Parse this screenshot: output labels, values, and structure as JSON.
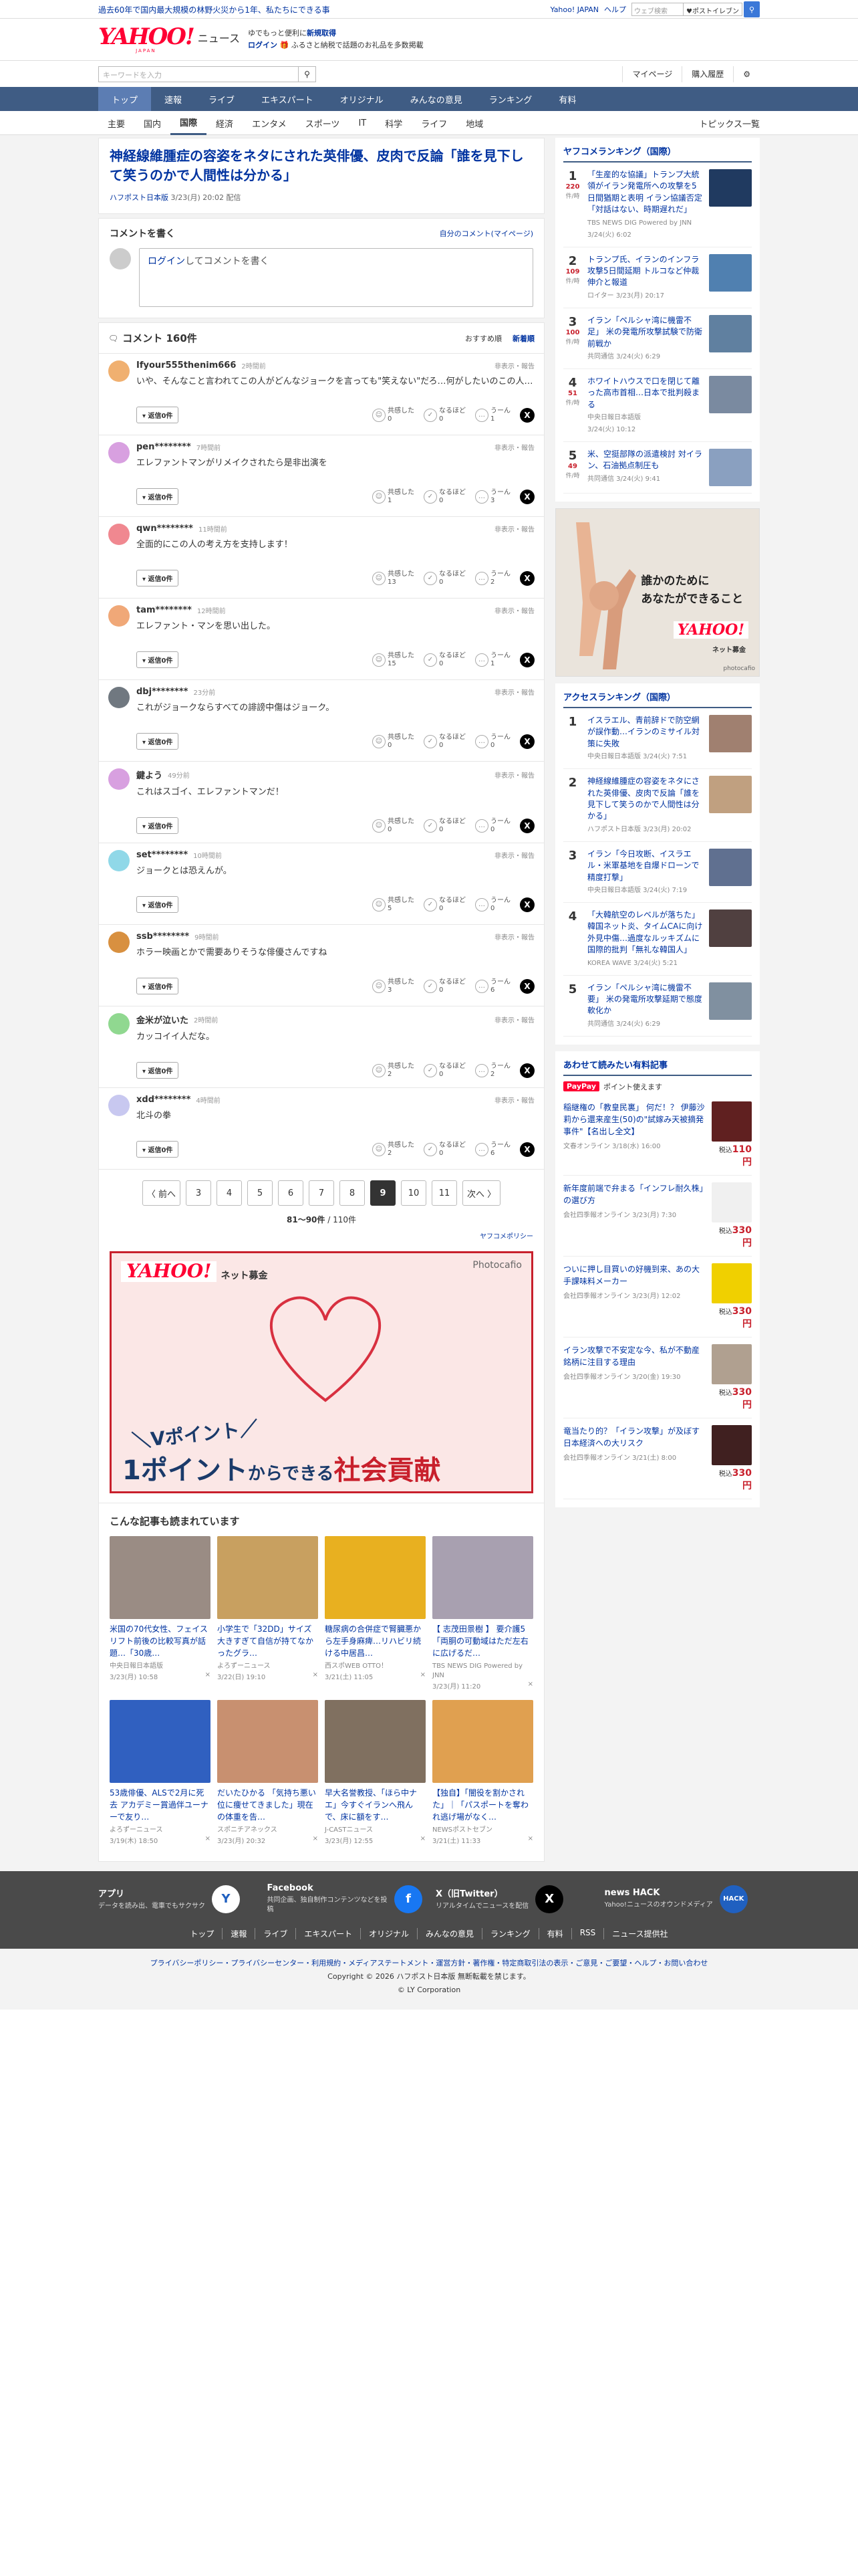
{
  "topbar": {
    "news": "過去60年で国内最大規模の林野火災から1年、私たちにできる事",
    "links": [
      "Yahoo! JAPAN",
      "ヘルプ"
    ],
    "search_placeholder": "ウェブ検索",
    "yell_label": "♥ポストイレブン"
  },
  "header": {
    "logo": "YAHOO!",
    "logo_sub": "JAPAN",
    "service": "ニュース",
    "promo_line1_pre": "ゆでもっと便利に",
    "promo_line1_link": "新規取得",
    "promo_line2_link": "ログイン",
    "promo_line2_text": "🎁 ふるさと納税で話題のお礼品を多数掲載"
  },
  "toolbar": {
    "search_placeholder": "キーワードを入力",
    "mypage": "マイページ",
    "history": "購入履歴"
  },
  "gnav": [
    "トップ",
    "速報",
    "ライブ",
    "エキスパート",
    "オリジナル",
    "みんなの意見",
    "ランキング",
    "有料"
  ],
  "gnav_active": 0,
  "snav": [
    "主要",
    "国内",
    "国際",
    "経済",
    "エンタメ",
    "スポーツ",
    "IT",
    "科学",
    "ライフ",
    "地域"
  ],
  "snav_right": "トピックス一覧",
  "article": {
    "title": "神経線維腫症の容姿をネタにされた英俳優、皮肉で反論「誰を見下して笑うのかで人間性は分かる」",
    "source": "ハフポスト日本版",
    "date": "3/23(月) 20:02 配信"
  },
  "comment_write": {
    "heading": "コメントを書く",
    "mine": "自分のコメント(マイページ)",
    "login": "ログイン",
    "placeholder": "してコメントを書く"
  },
  "comments_header": {
    "title": "コメント 160件",
    "sort_recommended": "おすすめ順",
    "sort_new": "新着順"
  },
  "comment_labels": {
    "report": "非表示・報告",
    "reply": "▾ 返信0件",
    "empathy": "共感した",
    "insight": "なるほど",
    "hmm": "うーん"
  },
  "comments": [
    {
      "user": "Ifyour555thenim666",
      "time": "2時間前",
      "text": "いや、そんなこと言われてこの人がどんなジョークを言っても\"笑えない\"だろ…何がしたいのこの人…",
      "empathy": "0",
      "insight": "0",
      "hmm": "1",
      "color": "#f0b070"
    },
    {
      "user": "pen********",
      "time": "7時間前",
      "text": "エレファントマンがリメイクされたら是非出演を",
      "empathy": "1",
      "insight": "0",
      "hmm": "3",
      "color": "#d8a0e0"
    },
    {
      "user": "qwn********",
      "time": "11時間前",
      "text": "全面的にこの人の考え方を支持します！",
      "empathy": "13",
      "insight": "0",
      "hmm": "2",
      "color": "#f08890"
    },
    {
      "user": "tam********",
      "time": "12時間前",
      "text": "エレファント・マンを思い出した。",
      "empathy": "15",
      "insight": "0",
      "hmm": "1",
      "color": "#f0a878"
    },
    {
      "user": "dbj********",
      "time": "23分前",
      "text": "これがジョークならすべての誹謗中傷はジョーク。",
      "empathy": "0",
      "insight": "0",
      "hmm": "0",
      "color": "#707880"
    },
    {
      "user": "鍵よう",
      "time": "49分前",
      "text": "これはスゴイ、エレファントマンだ！",
      "empathy": "0",
      "insight": "0",
      "hmm": "0",
      "color": "#d8a0e0"
    },
    {
      "user": "set********",
      "time": "10時間前",
      "text": "ジョークとは恐えんが。",
      "empathy": "5",
      "insight": "0",
      "hmm": "0",
      "color": "#90d8e8"
    },
    {
      "user": "ssb********",
      "time": "9時間前",
      "text": "ホラー映画とかで需要ありそうな俳優さんですね",
      "empathy": "3",
      "insight": "0",
      "hmm": "6",
      "color": "#d89040"
    },
    {
      "user": "金米が泣いた",
      "time": "2時間前",
      "text": "カッコイイ人だな。",
      "empathy": "2",
      "insight": "0",
      "hmm": "2",
      "color": "#90d890"
    },
    {
      "user": "xdd********",
      "time": "4時間前",
      "text": "北斗の拳",
      "empathy": "2",
      "insight": "0",
      "hmm": "6",
      "color": "#c8c8f0"
    }
  ],
  "pager": {
    "prev": "〈 前へ",
    "pages": [
      "3",
      "4",
      "5",
      "6",
      "7",
      "8",
      "9",
      "10",
      "11"
    ],
    "current": "9",
    "next": "次へ 〉",
    "info_range": "81〜90件",
    "info_total": " / 110件"
  },
  "policy": "ヤフコメポリシー",
  "ad_main": {
    "logo": "YAHOO!",
    "sub": "ネット募金",
    "photo": "Photocafio",
    "line1": "＼Vポイント／",
    "line2a": "1ポイント",
    "line2b": "からできる",
    "line2c": "社会貢献"
  },
  "also_read": {
    "heading": "こんな記事も読まれています",
    "items": [
      {
        "title": "米国の70代女性、フェイスリフト前後の比較写真が話題…「30歳…",
        "source": "中央日報日本語版",
        "date": "3/23(月) 10:58",
        "color": "#9a8c84"
      },
      {
        "title": "小学生で「32DD」サイズ 大きすぎて自信が持てなかったグラ…",
        "source": "よろずーニュース",
        "date": "3/22(日) 19:10",
        "color": "#c8a060"
      },
      {
        "title": "糖尿病の合併症で腎臓悪から左手身麻痺…リハビリ続ける中居昌…",
        "source": "西スポWEB OTTO！",
        "date": "3/21(土) 11:05",
        "color": "#e8b020"
      },
      {
        "title": "【 志茂田景樹 】 要介護5 「両胴の可動域はただ左右に広げるだ…",
        "source": "TBS NEWS DIG Powered by JNN",
        "date": "3/23(月) 11:20",
        "color": "#a8a0b0"
      },
      {
        "title": "53歳俳優、ALSで2月に死去 アカデミー賞過伴ユーナーで友り…",
        "source": "よろずーニュース",
        "date": "3/19(木) 18:50",
        "color": "#3060c0"
      },
      {
        "title": "だいたひかる 「気持ち悪い位に痩せてきました」現在の体重を告…",
        "source": "スポニチアネックス",
        "date": "3/23(月) 20:32",
        "color": "#c89070"
      },
      {
        "title": "早大名誉教授、「ほら中ナエ」今すぐイランへ飛んで、床に額をす…",
        "source": "J-CASTニュース",
        "date": "3/23(月) 12:55",
        "color": "#807060"
      },
      {
        "title": "【独自】「闇役を割かされた」｜「パスポートを奪われ逃げ場がなく…",
        "source": "NEWSポストセブン",
        "date": "3/21(土) 11:33",
        "color": "#e0a050"
      }
    ]
  },
  "sidebar": {
    "ranking_heading": "ヤフコメランキング（国際）",
    "count_unit": "件/時",
    "ranking": [
      {
        "rank": "1",
        "count": "220",
        "title": "「生産的な協議」トランプ大統領がイラン発電所への攻撃を5日間猶期と表明 イラン協議否定「対話はない、時期遅れだ」",
        "source": "TBS NEWS DIG Powered by JNN",
        "date": "3/24(火) 6:02",
        "color": "#203a60"
      },
      {
        "rank": "2",
        "count": "109",
        "title": "トランプ氏、イランのインフラ攻撃5日間延期 トルコなど仲裁伸介と報道",
        "source": "ロイター 3/23(月) 20:17",
        "date": "",
        "color": "#5080b0"
      },
      {
        "rank": "3",
        "count": "100",
        "title": "イラン「ペルシャ湾に機雷不足」 米の発電所攻撃試験で防衛前戦か",
        "source": "共同通信 3/24(火) 6:29",
        "date": "",
        "color": "#6080a0"
      },
      {
        "rank": "4",
        "count": "51",
        "title": "ホワイトハウスで口を閉じて離った高市首相…日本で批判殺まる",
        "source": "中央日報日本語版",
        "date": "3/24(火) 10:12",
        "color": "#7a8aa0"
      },
      {
        "rank": "5",
        "count": "49",
        "title": "米、空挺部隊の派遣検討 対イラン、石油拠点制圧も",
        "source": "共同通信 3/24(火) 9:41",
        "date": "",
        "color": "#8aa0c0"
      }
    ],
    "ad_msg1": "誰かのために",
    "ad_msg2": "あなたができること",
    "ad_logo": "YAHOO!",
    "ad_logo_sub": "ネット募金",
    "ad_photo": "photocafio",
    "access_heading": "アクセスランキング（国際）",
    "access": [
      {
        "rank": "1",
        "title": "イスラエル、青前辞ドで防空網が誤作動…イランのミサイル対策に失敗",
        "source": "中央日報日本語版 3/24(火) 7:51",
        "color": "#a08070"
      },
      {
        "rank": "2",
        "title": "神経線維腫症の容姿をネタにされた英俳優、皮肉で反論「誰を見下して笑うのかで人間性は分かる」",
        "source": "ハフポスト日本版 3/23(月) 20:02",
        "color": "#c0a080"
      },
      {
        "rank": "3",
        "title": "イラン「今日攻断、イスラエル・米軍基地を自爆ドローンで精度打撃」",
        "source": "中央日報日本語版 3/24(火) 7:19",
        "color": "#607090"
      },
      {
        "rank": "4",
        "title": "「大韓航空のレベルが落ちた」韓国ネット炎、タイムCAに向け外見中傷…過度なルッキズムに国際的批判「無礼な韓国人」",
        "source": "KOREA WAVE 3/24(火) 5:21",
        "color": "#504040"
      },
      {
        "rank": "5",
        "title": "イラン「ペルシャ湾に機雷不要」 米の発電所攻撃延期で態度軟化か",
        "source": "共同通信 3/24(火) 6:29",
        "color": "#8090a0"
      }
    ],
    "books_heading": "あわせて読みたい有料記事",
    "paypay": "PayPay",
    "paypay_text": "ポイント使えます",
    "price_prefix": "税込",
    "books": [
      {
        "title": "稲継権の「教皇民裏」 何だ！？ 伊藤沙莉から還来産生(50)の\"試嫁み天被摘発事件\"【名出し全文】",
        "source": "文春オンライン 3/18(水) 16:00",
        "price": "110円",
        "color": "#602020"
      },
      {
        "title": "新年度前端で弁まる「インフレ耐久株」の選び方",
        "source": "会社四季報オンライン 3/23(月) 7:30",
        "price": "330円",
        "color": "#f0f0f0"
      },
      {
        "title": "ついに押し目買いの好機到来、あの大手課味料メーカー",
        "source": "会社四季報オンライン 3/23(月) 12:02",
        "price": "330円",
        "color": "#f0d000"
      },
      {
        "title": "イラン攻撃で不安定な今、私が不動産銘柄に注目する理由",
        "source": "会社四季報オンライン 3/20(金) 19:30",
        "price": "330円",
        "color": "#b0a090"
      },
      {
        "title": "竜当たり的？「イラン攻撃」が及ぼす日本経済への大リスク",
        "source": "会社四季報オンライン 3/21(土) 8:00",
        "price": "330円",
        "color": "#402020"
      }
    ]
  },
  "footer": {
    "apps": [
      {
        "title": "アプリ",
        "desc": "データを読み出、電車でもサクサク",
        "icon": "Y"
      },
      {
        "title": "Facebook",
        "desc": "共同企画、独自制作コンテンツなどを投稿",
        "icon": "f"
      },
      {
        "title": "X（旧Twitter）",
        "desc": "リアルタイムでニュースを配信",
        "icon": "X"
      },
      {
        "title": "news HACK",
        "desc": "Yahoo!ニュースのオウンドメディア",
        "icon": "HACK"
      }
    ],
    "nav": [
      "トップ",
      "速報",
      "ライブ",
      "エキスパート",
      "オリジナル",
      "みんなの意見",
      "ランキング",
      "有料",
      "RSS",
      "ニュース提供社"
    ],
    "legal_links": "プライバシーポリシー・プライバシーセンター・利用規約・メディアステートメント・運営方針・著作権・特定商取引法の表示・ご意見・ご要望・ヘルプ・お問い合わせ",
    "copyright": "Copyright © 2026 ハフポスト日本版 無断転載を禁じます。",
    "corp": "© LY Corporation"
  }
}
